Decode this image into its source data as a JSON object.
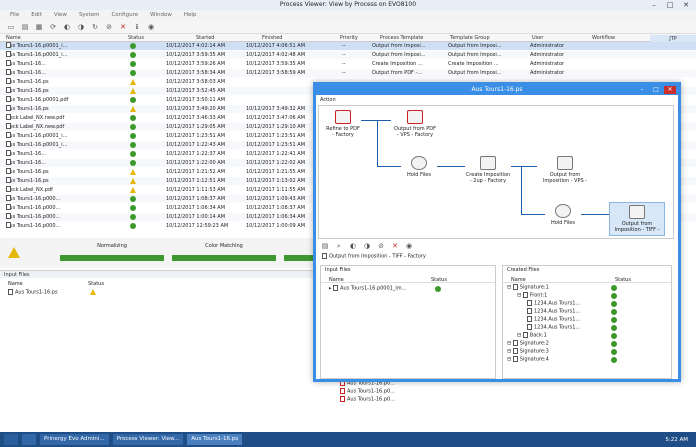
{
  "window": {
    "title": "Process Viewer: View by Process on EVO8100"
  },
  "menu": [
    "File",
    "Edit",
    "View",
    "System",
    "Configure",
    "Window",
    "Help"
  ],
  "table": {
    "headers": {
      "name": "Name",
      "status": "Status",
      "started": "Started",
      "finished": "Finished",
      "priority": "Priority",
      "process_template": "Process Template",
      "template_group": "Template Group",
      "user": "User",
      "workflow": "Workflow",
      "jtp": "JTP"
    },
    "rows": [
      {
        "name": "Aus Tours1-16.p0001_i...",
        "status": "ok",
        "started": "10/12/2017 4:02:14 AM",
        "finished": "10/12/2017 4:06:51 AM",
        "priority": "--",
        "template": "Output from Imposi...",
        "group": "Output from Imposi...",
        "user": "Administrator"
      },
      {
        "name": "Aus Tours1-16.p0001_i...",
        "status": "ok",
        "started": "10/12/2017 3:59:35 AM",
        "finished": "10/12/2017 4:02:48 AM",
        "priority": "--",
        "template": "Output from Imposi...",
        "group": "Output from Imposi...",
        "user": "Administrator"
      },
      {
        "name": "Aus Tours1-16...",
        "status": "ok",
        "started": "10/12/2017 3:59:26 AM",
        "finished": "10/12/2017 3:59:35 AM",
        "priority": "--",
        "template": "Create Imposition ...",
        "group": "Create Imposition ...",
        "user": "Administrator"
      },
      {
        "name": "Aus Tours1-16...",
        "status": "ok",
        "started": "10/12/2017 3:58:34 AM",
        "finished": "10/12/2017 3:58:59 AM",
        "priority": "--",
        "template": "Output from PDF -...",
        "group": "Output from Imposi...",
        "user": "Administrator"
      },
      {
        "name": "Aus Tours1-16.ps",
        "status": "warn",
        "started": "10/12/2017 3:58:03 AM",
        "finished": "",
        "priority": "",
        "template": "",
        "group": "",
        "user": ""
      },
      {
        "name": "Aus Tours1-16.ps",
        "status": "warn",
        "started": "10/12/2017 3:52:45 AM",
        "finished": "",
        "priority": "",
        "template": "",
        "group": "",
        "user": ""
      },
      {
        "name": "Aus Tours1-16.p0001.pdf",
        "status": "ok",
        "started": "10/12/2017 3:50:11 AM",
        "finished": "",
        "priority": "",
        "template": "",
        "group": "",
        "user": ""
      },
      {
        "name": "Aus Tours1-16.ps",
        "status": "warn",
        "started": "10/12/2017 3:49:20 AM",
        "finished": "10/12/2017 3:49:32 AM",
        "priority": "",
        "template": "",
        "group": "",
        "user": ""
      },
      {
        "name": "Neck Label_NX.new.pdf",
        "status": "ok",
        "started": "10/12/2017 3:46:33 AM",
        "finished": "10/12/2017 3:47:06 AM",
        "priority": "",
        "template": "",
        "group": "",
        "user": ""
      },
      {
        "name": "Neck Label_NX.new.pdf",
        "status": "ok",
        "started": "10/12/2017 1:29:05 AM",
        "finished": "10/12/2017 1:29:10 AM",
        "priority": "",
        "template": "",
        "group": "",
        "user": ""
      },
      {
        "name": "Aus Tours1-16.p0001_i...",
        "status": "ok",
        "started": "10/12/2017 1:23:51 AM",
        "finished": "10/12/2017 1:23:51 AM",
        "priority": "",
        "template": "",
        "group": "",
        "user": ""
      },
      {
        "name": "Aus Tours1-16.p0001_i...",
        "status": "ok",
        "started": "10/12/2017 1:22:43 AM",
        "finished": "10/12/2017 1:23:51 AM",
        "priority": "",
        "template": "",
        "group": "",
        "user": ""
      },
      {
        "name": "Aus Tours1-16...",
        "status": "ok",
        "started": "10/12/2017 1:22:37 AM",
        "finished": "10/12/2017 1:22:41 AM",
        "priority": "",
        "template": "",
        "group": "",
        "user": ""
      },
      {
        "name": "Aus Tours1-16...",
        "status": "ok",
        "started": "10/12/2017 1:22:00 AM",
        "finished": "10/12/2017 1:22:02 AM",
        "priority": "",
        "template": "",
        "group": "",
        "user": ""
      },
      {
        "name": "Aus Tours1-16.ps",
        "status": "warn",
        "started": "10/12/2017 1:21:52 AM",
        "finished": "10/12/2017 1:21:55 AM",
        "priority": "",
        "template": "",
        "group": "",
        "user": ""
      },
      {
        "name": "Aus Tours1-16.ps",
        "status": "warn",
        "started": "10/12/2017 1:12:51 AM",
        "finished": "10/12/2017 1:13:02 AM",
        "priority": "",
        "template": "",
        "group": "",
        "user": ""
      },
      {
        "name": "Neck Label_NX.pdf",
        "status": "warn",
        "started": "10/12/2017 1:11:53 AM",
        "finished": "10/12/2017 1:11:55 AM",
        "priority": "",
        "template": "",
        "group": "",
        "user": ""
      },
      {
        "name": "Aus Tours1-16.p000...",
        "status": "ok",
        "started": "10/12/2017 1:08:37 AM",
        "finished": "10/12/2017 1:09:43 AM",
        "priority": "",
        "template": "",
        "group": "",
        "user": ""
      },
      {
        "name": "Aus Tours1-16.p000...",
        "status": "ok",
        "started": "10/12/2017 1:06:34 AM",
        "finished": "10/12/2017 1:08:37 AM",
        "priority": "",
        "template": "",
        "group": "",
        "user": ""
      },
      {
        "name": "Aus Tours1-16.p000...",
        "status": "ok",
        "started": "10/12/2017 1:00:14 AM",
        "finished": "10/12/2017 1:06:34 AM",
        "priority": "",
        "template": "",
        "group": "",
        "user": ""
      },
      {
        "name": "Aus Tours1-16.p000...",
        "status": "ok",
        "started": "10/12/2017 12:59:23 AM",
        "finished": "10/12/2017 1:00:09 AM",
        "priority": "",
        "template": "",
        "group": "",
        "user": ""
      }
    ]
  },
  "progress": {
    "steps": [
      "Normalizing",
      "Color Matching"
    ]
  },
  "input_files": {
    "title": "Input Files",
    "col_name": "Name",
    "col_status": "Status",
    "file": "Aus Tours1-16.ps"
  },
  "dialog": {
    "title": "Aus Tours1-16.ps",
    "action_label": "Action",
    "nodes": {
      "refine": "Refine to PDF - Factory",
      "output_pdf": "Output from PDF - VPS - Factory",
      "hold1": "Hold Files",
      "impose": "Create Imposition - 2up - Factory",
      "output_vps": "Output from Imposition - VPS -",
      "hold2": "Hold Files",
      "output_tiff": "Output from Imposition - TIFF -"
    },
    "selected_node": "Output from Imposition - TIFF - Factory",
    "input_files_title": "Input Files",
    "created_files_title": "Created Files",
    "col_name": "Name",
    "col_status": "Status",
    "input_file": "Aus Tours1-16.p0001_im...",
    "tree": [
      {
        "label": "Signature:1",
        "depth": 1
      },
      {
        "label": "Front:1",
        "depth": 2
      },
      {
        "label": "1234.Aus Tours1...",
        "depth": 3
      },
      {
        "label": "1234.Aus Tours1...",
        "depth": 3
      },
      {
        "label": "1234.Aus Tours1...",
        "depth": 3
      },
      {
        "label": "1234.Aus Tours1...",
        "depth": 3
      },
      {
        "label": "Back:1",
        "depth": 2
      },
      {
        "label": "Signature:2",
        "depth": 1
      },
      {
        "label": "Signature:3",
        "depth": 1
      },
      {
        "label": "Signature:4",
        "depth": 1
      }
    ]
  },
  "bottom_right_list": [
    "Aus Tours1-16.p0...",
    "Aus Tours1-16.p0...",
    "Aus Tours1-16.p0..."
  ],
  "taskbar": {
    "items": [
      "Prinergy Evo Admini...",
      "Process Viewer: View...",
      "Aus Tours1-16.ps"
    ],
    "time": "5:22 AM"
  }
}
